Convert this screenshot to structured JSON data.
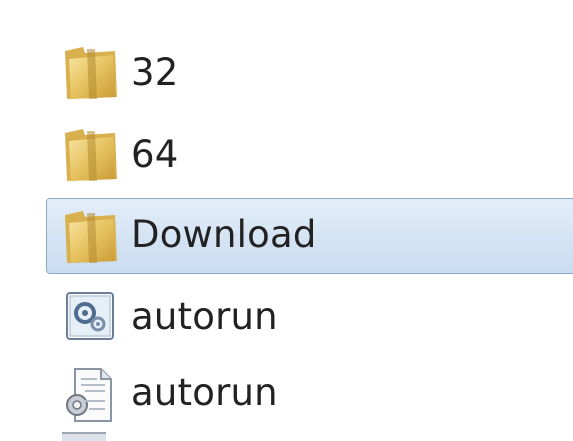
{
  "files": [
    {
      "name": "32",
      "icon": "folder-icon",
      "selected": false
    },
    {
      "name": "64",
      "icon": "folder-icon",
      "selected": false
    },
    {
      "name": "Download",
      "icon": "folder-icon",
      "selected": true
    },
    {
      "name": "autorun",
      "icon": "setup-info-icon",
      "selected": false
    },
    {
      "name": "autorun",
      "icon": "config-file-icon",
      "selected": false
    }
  ],
  "colors": {
    "selection_background": "#d8e6f5",
    "selection_border": "#8ea9c8",
    "folder": "#e8c860",
    "text": "#222222"
  }
}
